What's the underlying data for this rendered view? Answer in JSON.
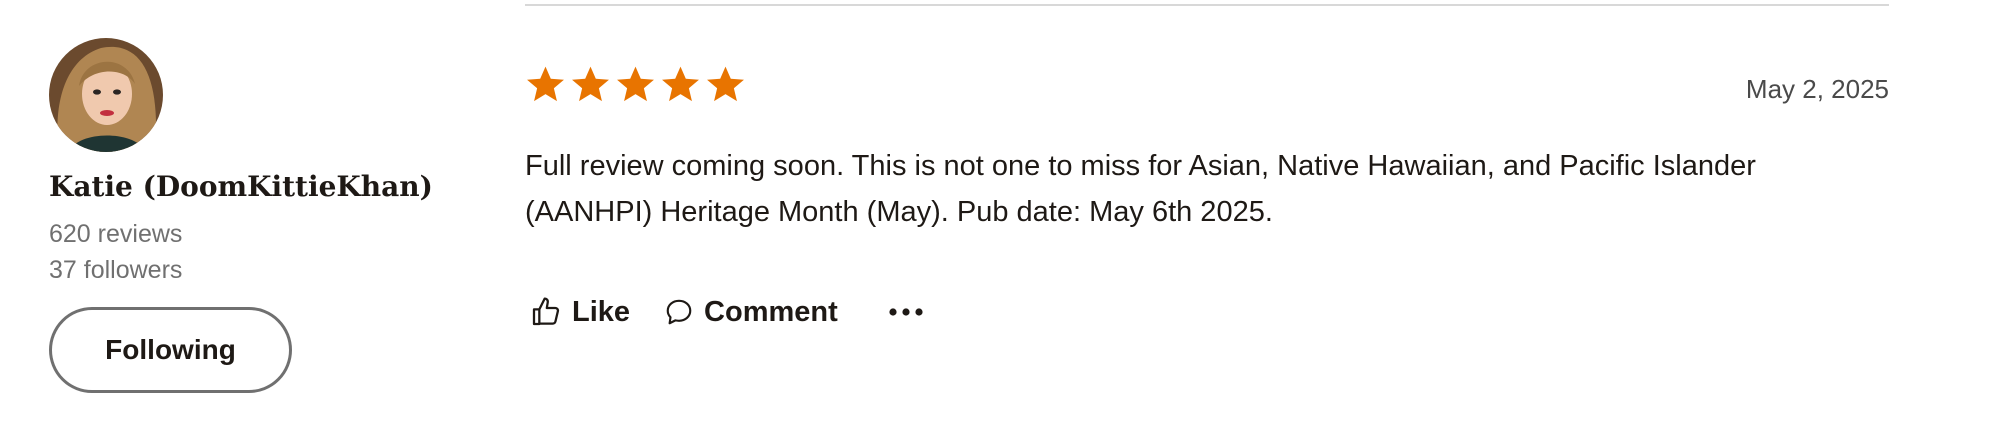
{
  "reviewer": {
    "name": "Katie (DoomKittieKhan)",
    "reviews_count": "620 reviews",
    "followers_count": "37 followers",
    "follow_button_label": "Following",
    "avatar_icon": "avatar-photo"
  },
  "review": {
    "rating": 5,
    "rating_max": 5,
    "star_color": "#e87400",
    "date": "May 2, 2025",
    "text": "Full review coming soon. This is not one to miss for Asian, Native Hawaiian, and Pacific Islander (AANHPI) Heritage Month (May). Pub date: May 6th 2025."
  },
  "actions": {
    "like_label": "Like",
    "like_icon": "thumbs-up-icon",
    "comment_label": "Comment",
    "comment_icon": "speech-bubble-icon",
    "more_icon": "more-options-icon"
  }
}
